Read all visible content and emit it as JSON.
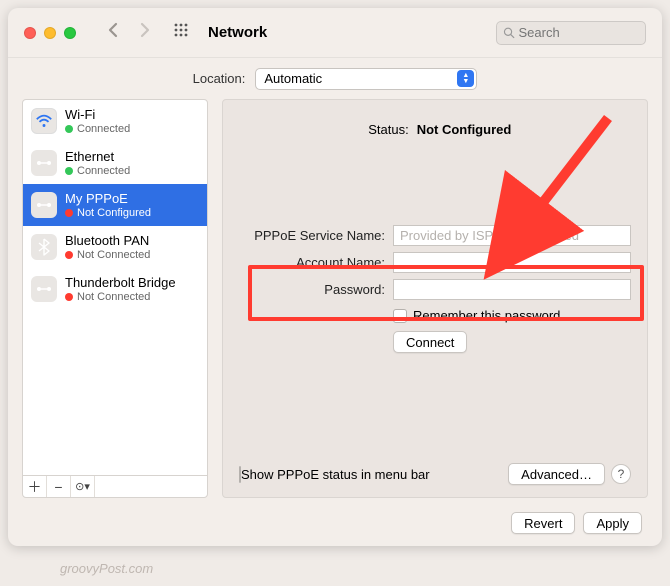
{
  "window": {
    "title": "Network"
  },
  "search": {
    "placeholder": "Search"
  },
  "location": {
    "label": "Location:",
    "value": "Automatic"
  },
  "sidebar": {
    "items": [
      {
        "name": "Wi-Fi",
        "sub": "Connected",
        "dot": "green",
        "iconClass": "wifi-icon",
        "glyph": "wifi"
      },
      {
        "name": "Ethernet",
        "sub": "Connected",
        "dot": "green",
        "iconClass": "eth-icon",
        "glyph": "eth"
      },
      {
        "name": "My PPPoE",
        "sub": "Not Configured",
        "dot": "red",
        "iconClass": "pppoe-icon",
        "glyph": "eth",
        "selected": true
      },
      {
        "name": "Bluetooth PAN",
        "sub": "Not Connected",
        "dot": "red",
        "iconClass": "bt-icon",
        "glyph": "bt"
      },
      {
        "name": "Thunderbolt Bridge",
        "sub": "Not Connected",
        "dot": "red",
        "iconClass": "tb-icon",
        "glyph": "eth"
      }
    ],
    "footer": {
      "add": "+",
      "remove": "−",
      "more": "☺︎",
      "menu": "▾"
    }
  },
  "panel": {
    "status": {
      "label": "Status:",
      "value": "Not Configured"
    },
    "pppoe_service_label": "PPPoE Service Name:",
    "pppoe_service_placeholder": "Provided by ISP when required",
    "account_label": "Account Name:",
    "password_label": "Password:",
    "remember_label": "Remember this password",
    "connect_label": "Connect",
    "show_status_label": "Show PPPoE status in menu bar",
    "advanced_label": "Advanced…"
  },
  "buttons": {
    "revert": "Revert",
    "apply": "Apply"
  },
  "watermark": "groovyPost.com"
}
